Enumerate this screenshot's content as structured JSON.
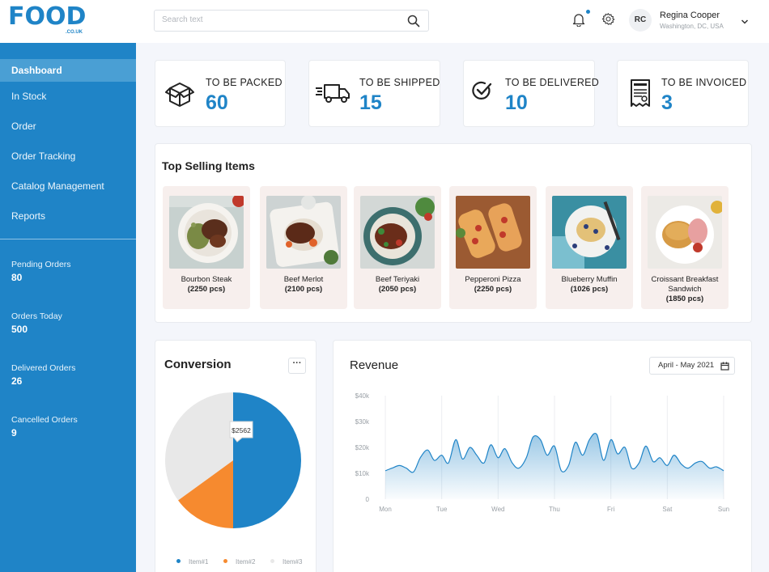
{
  "brand": {
    "logo_text": "FOOD",
    "logo_sub": ".CO.UK",
    "color": "#1f84c7"
  },
  "search": {
    "placeholder": "Search text"
  },
  "user": {
    "initials": "RC",
    "name": "Regina Cooper",
    "location": "Washington, DC, USA"
  },
  "sidebar": {
    "nav": [
      {
        "label": "Dashboard",
        "active": true
      },
      {
        "label": "In Stock"
      },
      {
        "label": "Order"
      },
      {
        "label": "Order Tracking"
      },
      {
        "label": "Catalog Management"
      },
      {
        "label": "Reports"
      }
    ],
    "stats": [
      {
        "label": "Pending Orders",
        "value": "80"
      },
      {
        "label": "Orders Today",
        "value": "500"
      },
      {
        "label": "Delivered Orders",
        "value": "26"
      },
      {
        "label": "Cancelled Orders",
        "value": "9"
      }
    ]
  },
  "kpis": [
    {
      "label": "TO BE PACKED",
      "value": "60",
      "icon": "box-icon"
    },
    {
      "label": "TO BE SHIPPED",
      "value": "15",
      "icon": "truck-icon"
    },
    {
      "label": "TO BE DELIVERED",
      "value": "10",
      "icon": "check-circle-icon"
    },
    {
      "label": "TO BE INVOICED",
      "value": "3",
      "icon": "invoice-icon"
    }
  ],
  "top_selling": {
    "title": "Top Selling Items",
    "items": [
      {
        "name": "Bourbon Steak",
        "qty": "(2250 pcs)"
      },
      {
        "name": "Beef Merlot",
        "qty": "(2100 pcs)"
      },
      {
        "name": "Beef Teriyaki",
        "qty": "(2050 pcs)"
      },
      {
        "name": "Pepperoni Pizza",
        "qty": "(2250 pcs)"
      },
      {
        "name": "Blueberry Muffin",
        "qty": "(1026 pcs)"
      },
      {
        "name": "Croissant Breakfast Sandwich",
        "qty": "(1850 pcs)"
      }
    ]
  },
  "conversion": {
    "title": "Conversion",
    "more_label": "···",
    "tooltip": "$2562",
    "legend": [
      "Item#1",
      "Item#2",
      "Item#3"
    ],
    "colors": [
      "#1f84c7",
      "#f68a2f",
      "#e8e8e8"
    ]
  },
  "revenue": {
    "title": "Revenue",
    "date_range": "April - May 2021"
  },
  "chart_data": [
    {
      "type": "pie",
      "title": "Conversion",
      "labels": [
        "Item#1",
        "Item#2",
        "Item#3"
      ],
      "values": [
        50,
        15,
        35
      ],
      "colors": [
        "#1f84c7",
        "#f68a2f",
        "#e8e8e8"
      ],
      "annotation": "$2562",
      "legend_position": "bottom"
    },
    {
      "type": "area",
      "title": "Revenue",
      "categories": [
        "Mon",
        "Tue",
        "Wed",
        "Thu",
        "Fri",
        "Sat",
        "Sun"
      ],
      "y_ticks": [
        "0",
        "$10k",
        "$20k",
        "$30k",
        "$40k"
      ],
      "ylim": [
        0,
        40000
      ],
      "grid": true,
      "color": "#1f84c7",
      "x": [
        0,
        0.12,
        0.25,
        0.37,
        0.5,
        0.62,
        0.75,
        0.87,
        1.0,
        1.12,
        1.25,
        1.37,
        1.5,
        1.62,
        1.75,
        1.87,
        2.0,
        2.12,
        2.25,
        2.37,
        2.5,
        2.62,
        2.75,
        2.87,
        3.0,
        3.12,
        3.25,
        3.37,
        3.5,
        3.62,
        3.75,
        3.87,
        4.0,
        4.12,
        4.25,
        4.37,
        4.5,
        4.62,
        4.75,
        4.87,
        5.0,
        5.12,
        5.25,
        5.37,
        5.5,
        5.62,
        5.75,
        5.87,
        6.0
      ],
      "values": [
        11000,
        12000,
        13000,
        12000,
        10500,
        16000,
        19000,
        15000,
        17000,
        14000,
        23000,
        15500,
        20000,
        17000,
        14000,
        21000,
        16000,
        19500,
        14000,
        12000,
        16000,
        24000,
        23000,
        17000,
        20500,
        11000,
        13000,
        22000,
        17000,
        23000,
        25000,
        15000,
        23000,
        17500,
        20000,
        12000,
        14000,
        20500,
        14500,
        16000,
        13000,
        17000,
        13500,
        12000,
        14000,
        14500,
        12000,
        12500,
        11000
      ]
    }
  ]
}
